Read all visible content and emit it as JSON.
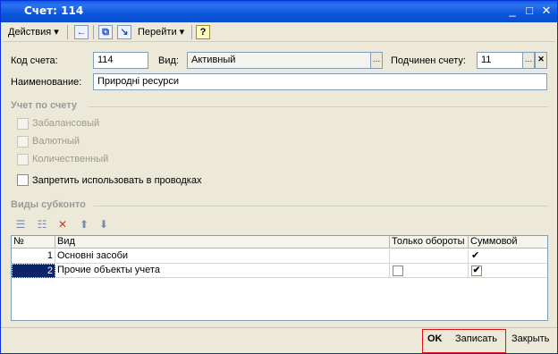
{
  "window": {
    "title": "Счет: 114"
  },
  "toolbar": {
    "actions_label": "Действия",
    "goto_label": "Перейти",
    "help_label": "?"
  },
  "form": {
    "code_label": "Код счета:",
    "code_value": "114",
    "kind_label": "Вид:",
    "kind_value": "Активный",
    "parent_label": "Подчинен счету:",
    "parent_value": "11",
    "name_label": "Наименование:",
    "name_value": "Природні ресурси"
  },
  "accounting": {
    "title": "Учет по счету",
    "offbalance_label": "Забалансовый",
    "currency_label": "Валютный",
    "quantity_label": "Количественный",
    "forbid_label": "Запретить использовать в проводках"
  },
  "subconto": {
    "title": "Виды субконто",
    "columns": {
      "num": "№",
      "kind": "Вид",
      "turnover_only": "Только обороты",
      "sum": "Суммовой"
    },
    "rows": [
      {
        "num": "1",
        "kind": "Основні засоби",
        "turnover_only": false,
        "sum": true
      },
      {
        "num": "2",
        "kind": "Прочие объекты учета",
        "turnover_only": false,
        "sum": true
      }
    ]
  },
  "footer": {
    "ok_label": "OK",
    "save_label": "Записать",
    "close_label": "Закрыть"
  },
  "colors": {
    "titlebar": "#0a5fe6",
    "selection": "#0a246a",
    "highlight_border": "#e01010"
  }
}
